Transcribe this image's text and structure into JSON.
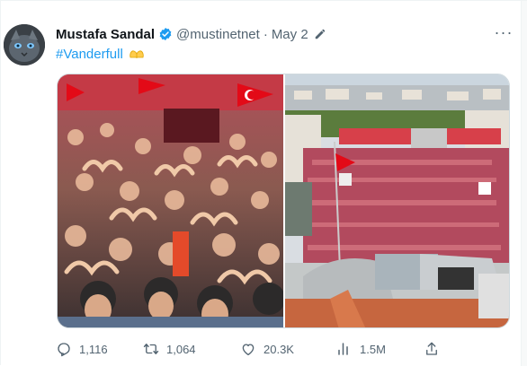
{
  "tweet": {
    "author_name": "Mustafa Sandal",
    "handle": "@mustinetnet",
    "separator": "·",
    "date": "May 2",
    "hashtag": "#Vanderfull",
    "more_label": "···"
  },
  "icons": {
    "verified": "verified-badge-icon",
    "edit": "edit-pencil-icon",
    "hands": "heart-hands-emoji-icon",
    "reply": "reply-icon",
    "retweet": "retweet-icon",
    "like": "like-icon",
    "views": "views-icon",
    "share": "share-icon"
  },
  "media": {
    "left_alt": "crowd making heart hands",
    "right_alt": "aerial view of rally crowd"
  },
  "actions": {
    "reply_count": "1,116",
    "retweet_count": "1,064",
    "like_count": "20.3K",
    "view_count": "1.5M"
  },
  "colors": {
    "accent": "#1d9bf0",
    "muted": "#536471",
    "flag_red": "#e30a17"
  }
}
